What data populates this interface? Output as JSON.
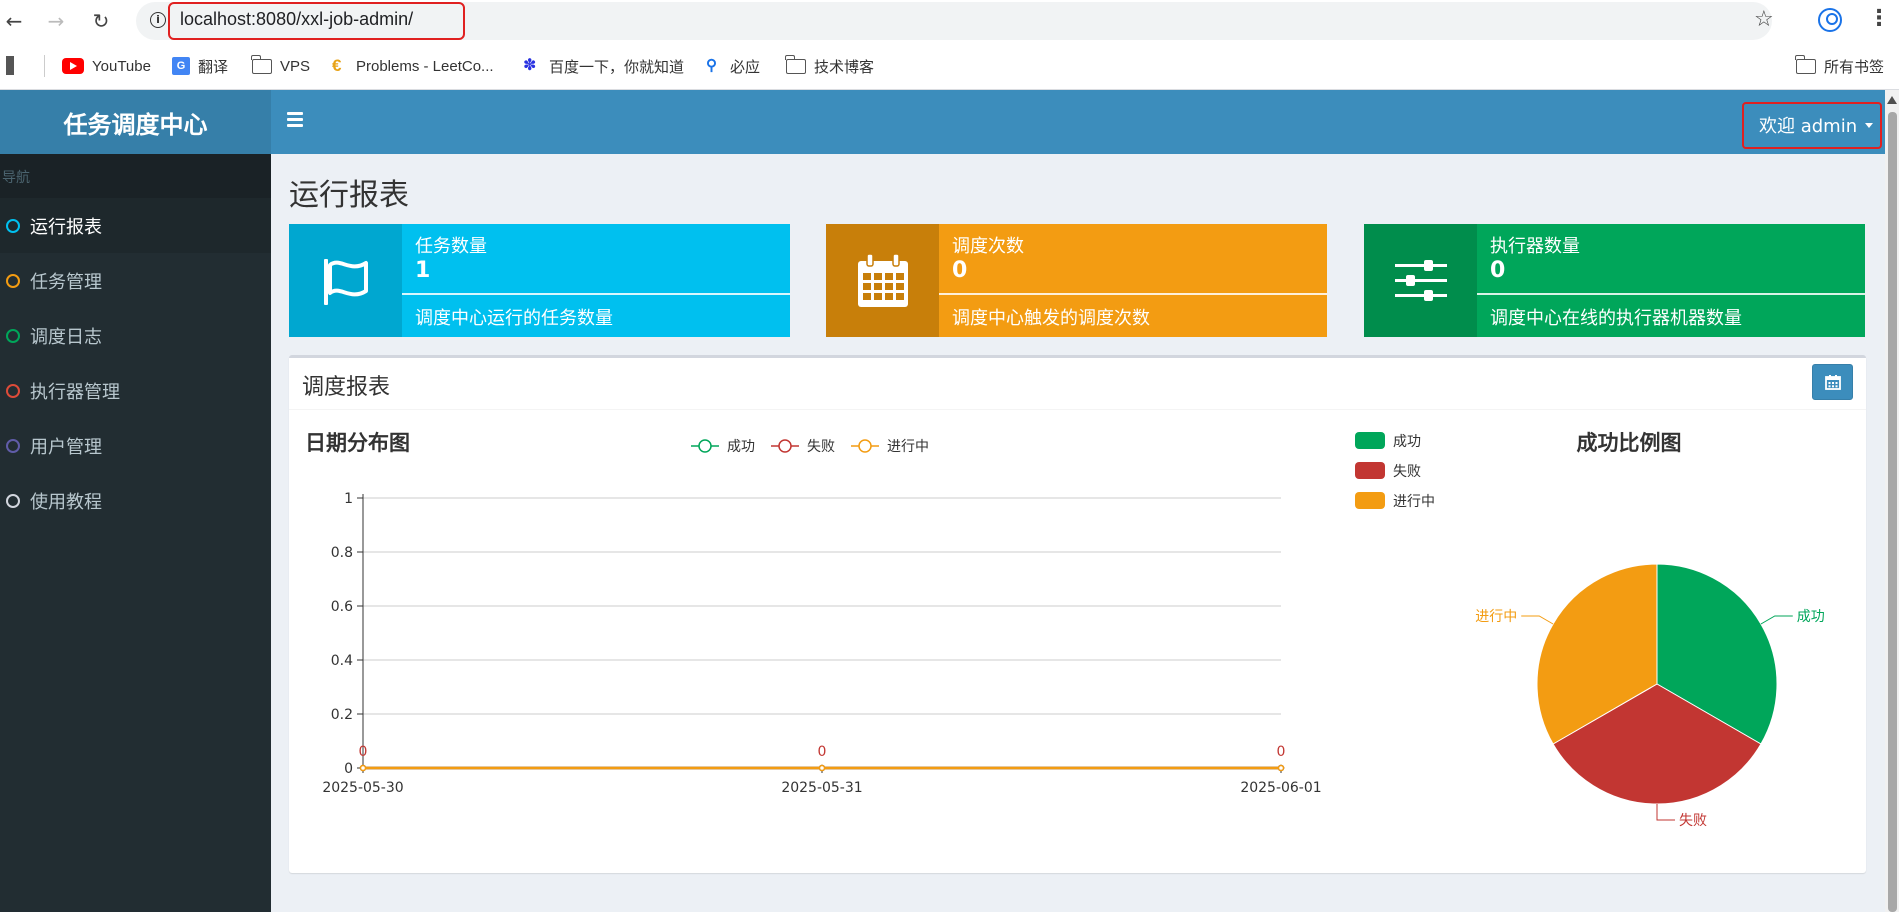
{
  "browser": {
    "url": "localhost:8080/xxl-job-admin/",
    "bookmarks": [
      "YouTube",
      "翻译",
      "VPS",
      "Problems - LeetCo...",
      "百度一下，你就知道",
      "必应",
      "技术博客"
    ],
    "all_bookmarks": "所有书签"
  },
  "app": {
    "logo": "任务调度中心",
    "user_menu": "欢迎 admin",
    "nav_header": "导航",
    "nav": [
      {
        "label": "运行报表",
        "color": "#00c0ef"
      },
      {
        "label": "任务管理",
        "color": "#f39c12"
      },
      {
        "label": "调度日志",
        "color": "#00a65a"
      },
      {
        "label": "执行器管理",
        "color": "#dd4b39"
      },
      {
        "label": "用户管理",
        "color": "#605ca8"
      },
      {
        "label": "使用教程",
        "color": "#d2d6de"
      }
    ],
    "page_title": "运行报表",
    "info_boxes": [
      {
        "title": "任务数量",
        "value": "1",
        "desc": "调度中心运行的任务数量",
        "icon": "flag-icon",
        "color": "#00c0ef",
        "icon_bg": "#00a7d0"
      },
      {
        "title": "调度次数",
        "value": "0",
        "desc": "调度中心触发的调度次数",
        "icon": "calendar-icon",
        "color": "#f39c12",
        "icon_bg": "#c87f0a"
      },
      {
        "title": "执行器数量",
        "value": "0",
        "desc": "调度中心在线的执行器机器数量",
        "icon": "sliders-icon",
        "color": "#00a65a",
        "icon_bg": "#008d4c"
      }
    ],
    "report_title": "调度报表"
  },
  "chart_data": [
    {
      "type": "line",
      "title": "日期分布图",
      "x": [
        "2025-05-30",
        "2025-05-31",
        "2025-06-01"
      ],
      "ylim": [
        0,
        1
      ],
      "yticks": [
        "0",
        "0.2",
        "0.4",
        "0.6",
        "0.8",
        "1"
      ],
      "grid": true,
      "legend": "top-center",
      "series": [
        {
          "name": "成功",
          "values": [
            0,
            0,
            0
          ],
          "color": "#00a65a"
        },
        {
          "name": "失败",
          "values": [
            0,
            0,
            0
          ],
          "color": "#c23632"
        },
        {
          "name": "进行中",
          "values": [
            0,
            0,
            0
          ],
          "color": "#f39c12"
        }
      ],
      "data_labels": [
        "0",
        "0",
        "0"
      ]
    },
    {
      "type": "pie",
      "title": "成功比例图",
      "legend": "top-left",
      "slices": [
        {
          "name": "成功",
          "value": 1,
          "color": "#00a65a"
        },
        {
          "name": "失败",
          "value": 1,
          "color": "#c23632"
        },
        {
          "name": "进行中",
          "value": 1,
          "color": "#f39c12"
        }
      ]
    }
  ]
}
